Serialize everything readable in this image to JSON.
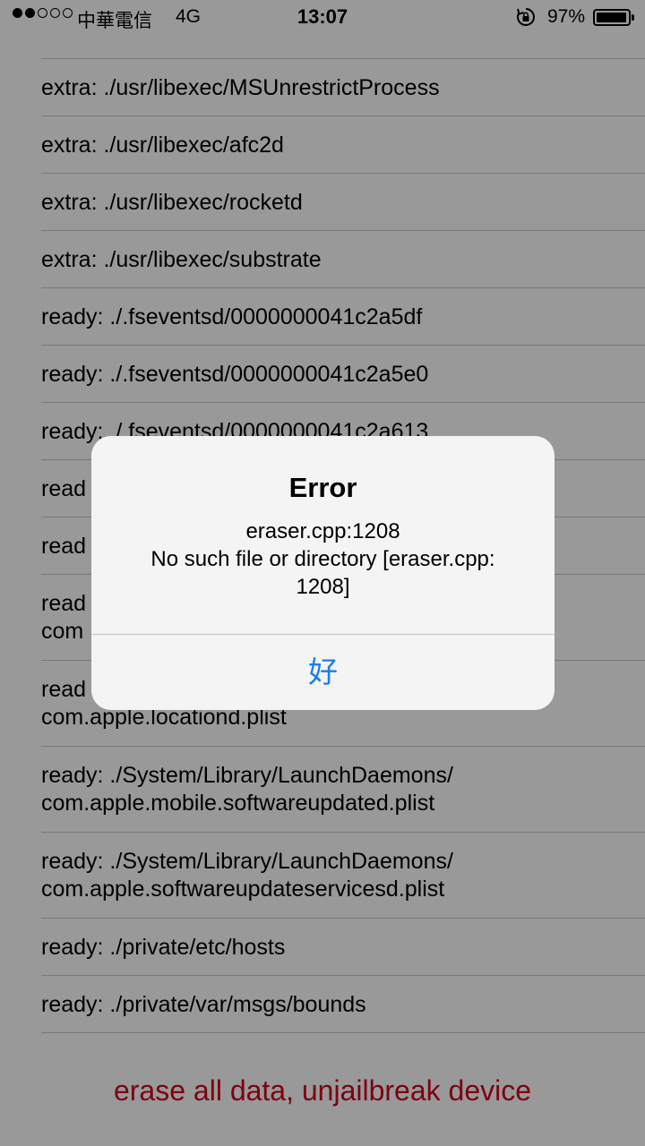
{
  "status_bar": {
    "carrier": "中華電信",
    "network": "4G",
    "time": "13:07",
    "battery_percent": "97%",
    "battery_level": 0.97,
    "signal_bars_filled": 2,
    "signal_bars_total": 5,
    "orientation_lock_icon": "rotation-lock-icon"
  },
  "log_list": {
    "rows": [
      {
        "line1": "extra: ./usr/libexec/MSUnrestrictProcess"
      },
      {
        "line1": "extra: ./usr/libexec/afc2d"
      },
      {
        "line1": "extra: ./usr/libexec/rocketd"
      },
      {
        "line1": "extra: ./usr/libexec/substrate"
      },
      {
        "line1": "ready: ./.fseventsd/0000000041c2a5df"
      },
      {
        "line1": "ready: ./.fseventsd/0000000041c2a5e0"
      },
      {
        "line1": "ready: ./.fseventsd/0000000041c2a613"
      },
      {
        "line1": "read"
      },
      {
        "line1": "read"
      },
      {
        "line1": "read",
        "line2": "com"
      },
      {
        "line1": "read",
        "line2": "com.apple.locationd.plist"
      },
      {
        "line1": "ready: ./System/Library/LaunchDaemons/",
        "line2": "com.apple.mobile.softwareupdated.plist"
      },
      {
        "line1": "ready: ./System/Library/LaunchDaemons/",
        "line2": "com.apple.softwareupdateservicesd.plist"
      },
      {
        "line1": "ready: ./private/etc/hosts"
      },
      {
        "line1": "ready: ./private/var/msgs/bounds"
      }
    ]
  },
  "footer": {
    "action_label": "erase all data, unjailbreak device",
    "action_color": "#d0021b"
  },
  "alert": {
    "title": "Error",
    "message_lines": [
      "eraser.cpp:1208",
      "No such file or directory [eraser.cpp:",
      "1208]"
    ],
    "button_label": "好",
    "button_color": "#1a7cf0"
  }
}
